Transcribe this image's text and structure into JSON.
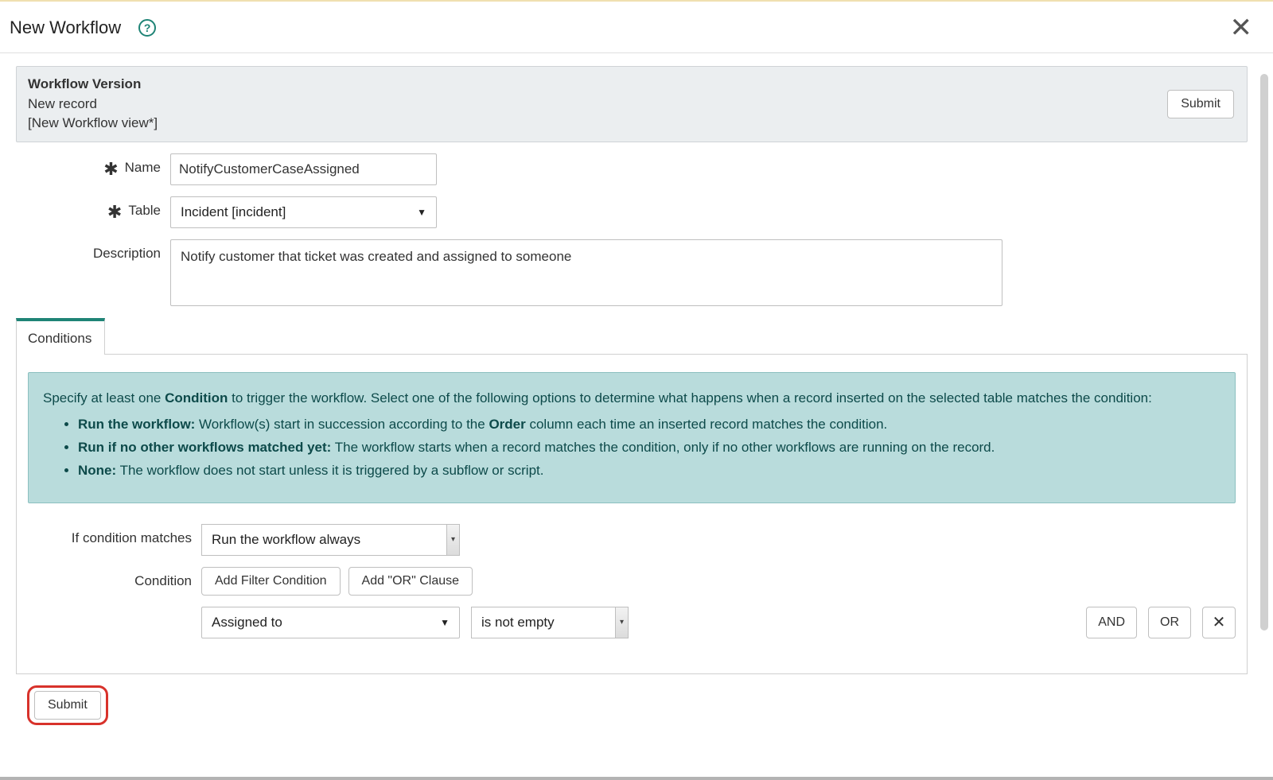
{
  "modal": {
    "title": "New Workflow",
    "close_glyph": "✕"
  },
  "panel": {
    "title": "Workflow Version",
    "line2": "New record",
    "line3": "[New Workflow view*]",
    "submit_label": "Submit"
  },
  "form": {
    "name_label": "Name",
    "name_value": "NotifyCustomerCaseAssigned",
    "table_label": "Table",
    "table_value": "Incident [incident]",
    "description_label": "Description",
    "description_value": "Notify customer that ticket was created and assigned to someone"
  },
  "tabs": {
    "conditions_label": "Conditions"
  },
  "info": {
    "lead_a": "Specify at least one ",
    "lead_bold1": "Condition",
    "lead_b": " to trigger the workflow. Select one of the following options to determine what happens when a record inserted on the selected table matches the condition:",
    "bullet1_bold": "Run the workflow:",
    "bullet1_rest_a": " Workflow(s) start in succession according to the ",
    "bullet1_order": "Order",
    "bullet1_rest_b": " column each time an inserted record matches the condition.",
    "bullet2_bold": "Run if no other workflows matched yet:",
    "bullet2_rest": " The workflow starts when a record matches the condition, only if no other workflows are running on the record.",
    "bullet3_bold": "None:",
    "bullet3_rest": " The workflow does not start unless it is triggered by a subflow or script."
  },
  "cond": {
    "ifmatch_label": "If condition matches",
    "ifmatch_value": "Run the workflow always",
    "condition_label": "Condition",
    "add_filter_label": "Add Filter Condition",
    "add_or_label": "Add \"OR\" Clause",
    "field_value": "Assigned to",
    "operator_value": "is not empty",
    "and_label": "AND",
    "or_label": "OR",
    "remove_glyph": "✕"
  },
  "footer": {
    "submit_label": "Submit"
  },
  "glyphs": {
    "help_q": "?",
    "caret_down_solid": "▼"
  }
}
